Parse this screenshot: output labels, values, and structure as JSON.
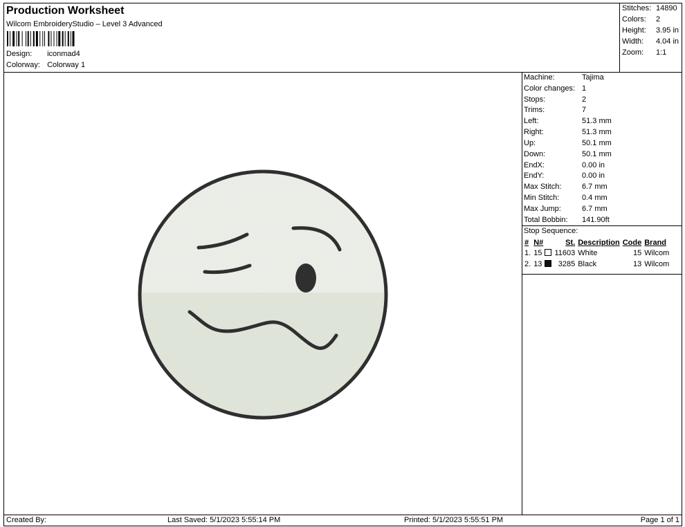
{
  "header": {
    "title": "Production Worksheet",
    "subtitle": "Wilcom EmbroideryStudio – Level 3 Advanced",
    "design_label": "Design:",
    "design_value": "iconmad4",
    "colorway_label": "Colorway:",
    "colorway_value": "Colorway 1"
  },
  "summary": [
    {
      "label": "Stitches:",
      "value": "14890"
    },
    {
      "label": "Colors:",
      "value": "2"
    },
    {
      "label": "Height:",
      "value": "3.95 in"
    },
    {
      "label": "Width:",
      "value": "4.04 in"
    },
    {
      "label": "Zoom:",
      "value": "1:1"
    }
  ],
  "machine_info": [
    {
      "label": "Machine:",
      "value": "Tajima"
    },
    {
      "label": "Color changes:",
      "value": "1"
    },
    {
      "label": "Stops:",
      "value": "2"
    },
    {
      "label": "Trims:",
      "value": "7"
    },
    {
      "label": "Left:",
      "value": "51.3 mm"
    },
    {
      "label": "Right:",
      "value": "51.3 mm"
    },
    {
      "label": "Up:",
      "value": "50.1 mm"
    },
    {
      "label": "Down:",
      "value": "50.1 mm"
    },
    {
      "label": "EndX:",
      "value": "0.00 in"
    },
    {
      "label": "EndY:",
      "value": "0.00 in"
    },
    {
      "label": "Max Stitch:",
      "value": "6.7 mm"
    },
    {
      "label": "Min Stitch:",
      "value": "0.4 mm"
    },
    {
      "label": "Max Jump:",
      "value": "6.7 mm"
    },
    {
      "label": "Total Bobbin:",
      "value": "141.90ft"
    }
  ],
  "stop_sequence": {
    "title": "Stop Sequence:",
    "columns": [
      "#",
      "N#",
      "St.",
      "Description",
      "Code",
      "Brand"
    ],
    "rows": [
      {
        "idx": "1.",
        "needle": "15",
        "swatch_color": "#ffffff",
        "stitches": "11603",
        "description": "White",
        "code": "15",
        "brand": "Wilcom"
      },
      {
        "idx": "2.",
        "needle": "13",
        "swatch_color": "#111111",
        "stitches": "3285",
        "description": "Black",
        "code": "13",
        "brand": "Wilcom"
      }
    ]
  },
  "design_colors": {
    "fill_top": "#e9ece5",
    "fill_bottom": "#dde2d6",
    "stroke": "#2f2f2f"
  },
  "footer": {
    "created_by": "Created By:",
    "last_saved": "Last Saved: 5/1/2023 5:55:14 PM",
    "printed": "Printed: 5/1/2023 5:55:51 PM",
    "page": "Page 1 of 1"
  }
}
